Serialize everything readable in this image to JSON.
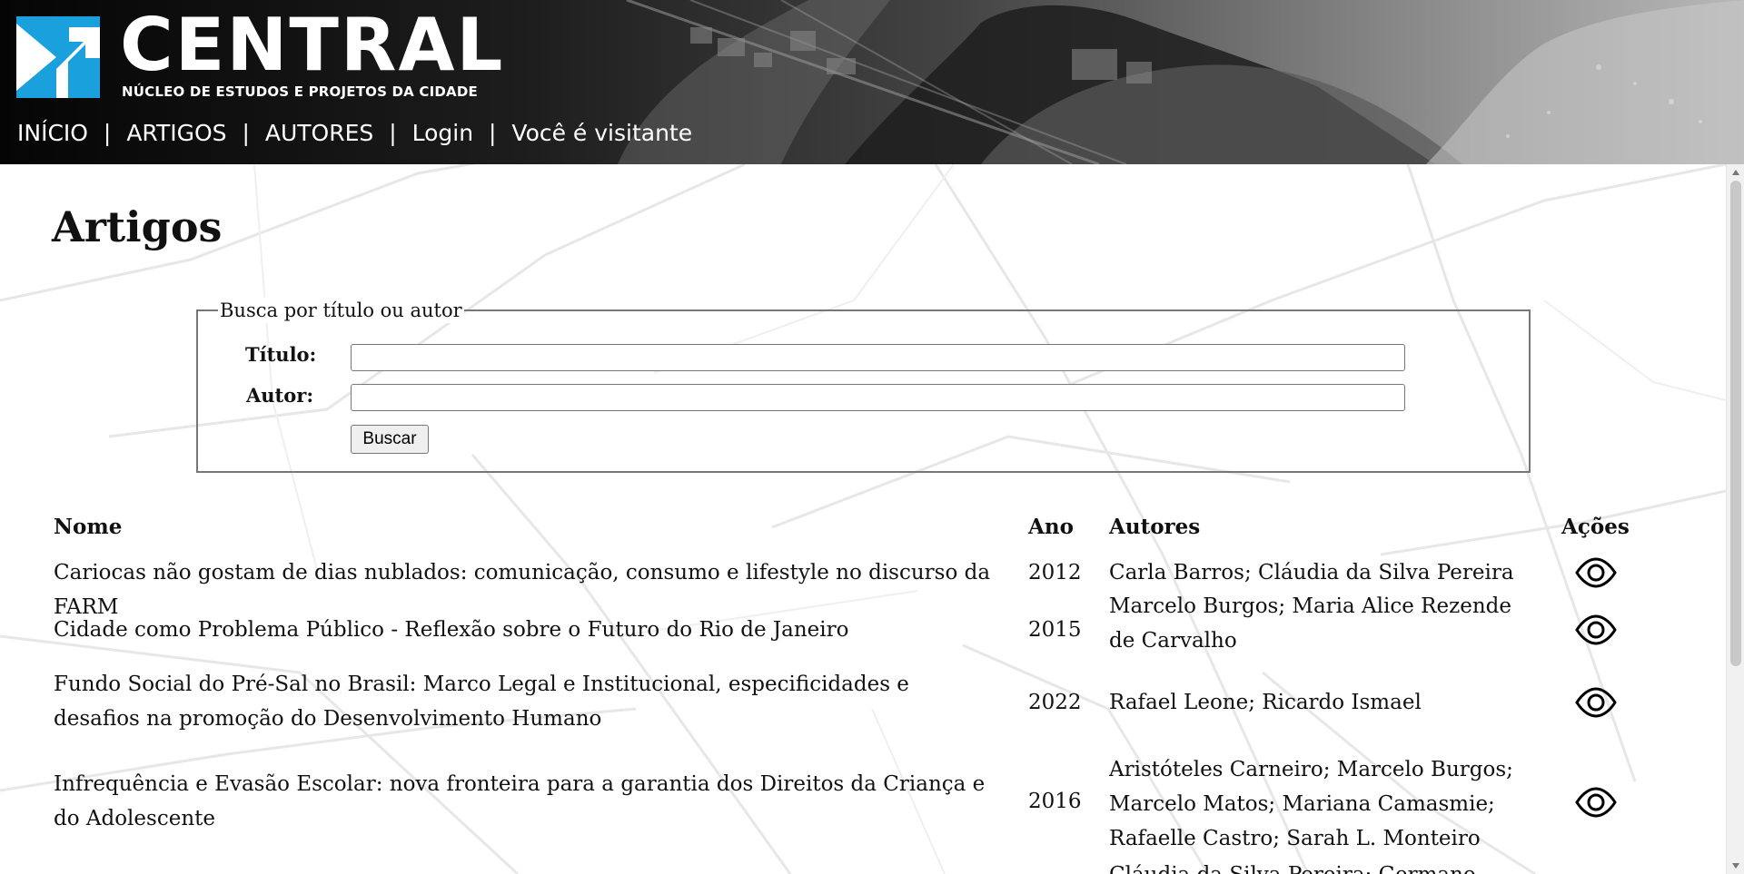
{
  "header": {
    "brand": "CENTRAL",
    "subtitle": "NÚCLEO DE ESTUDOS E PROJETOS DA CIDADE",
    "nav_separator": "|",
    "nav": [
      {
        "label": "INÍCIO"
      },
      {
        "label": "ARTIGOS"
      },
      {
        "label": "AUTORES"
      },
      {
        "label": "Login"
      },
      {
        "label": "Você é visitante"
      }
    ]
  },
  "page": {
    "title": "Artigos"
  },
  "search": {
    "legend": "Busca por título ou autor",
    "title_label": "Título:",
    "author_label": "Autor:",
    "title_value": "",
    "author_value": "",
    "button_label": "Buscar"
  },
  "table": {
    "headers": {
      "name": "Nome",
      "year": "Ano",
      "authors": "Autores",
      "actions": "Ações"
    },
    "rows": [
      {
        "name": "Cariocas não gostam de dias nublados: comunicação, consumo e lifestyle no discurso da FARM",
        "year": "2012",
        "authors": "Carla Barros; Cláudia da Silva Pereira",
        "action_icon": "eye-icon"
      },
      {
        "name": "Cidade como Problema Público - Reflexão sobre o Futuro do Rio de Janeiro",
        "year": "2015",
        "authors": "Marcelo Burgos; Maria Alice Rezende de Carvalho",
        "action_icon": "eye-icon"
      },
      {
        "name": "Fundo Social do Pré-Sal no Brasil: Marco Legal e Institucional, especificidades e desafios na promoção do Desenvolvimento Humano",
        "year": "2022",
        "authors": "Rafael Leone; Ricardo Ismael",
        "action_icon": "eye-icon"
      },
      {
        "name": "Infrequência e Evasão Escolar: nova fronteira para a garantia dos Direitos da Criança e do Adolescente",
        "year": "2016",
        "authors": "Aristóteles Carneiro; Marcelo Burgos; Marcelo Matos; Mariana Camasmie; Rafaelle Castro; Sarah L. Monteiro",
        "action_icon": "eye-icon"
      },
      {
        "name": "",
        "year": "",
        "authors": "Cláudia da Silva Pereira; Germano",
        "action_icon": ""
      }
    ]
  },
  "colors": {
    "brand_blue": "#1aa0dc",
    "header_text": "#ffffff",
    "page_background": "#ffffff",
    "border_gray": "#777777",
    "button_gray": "#efefef"
  }
}
